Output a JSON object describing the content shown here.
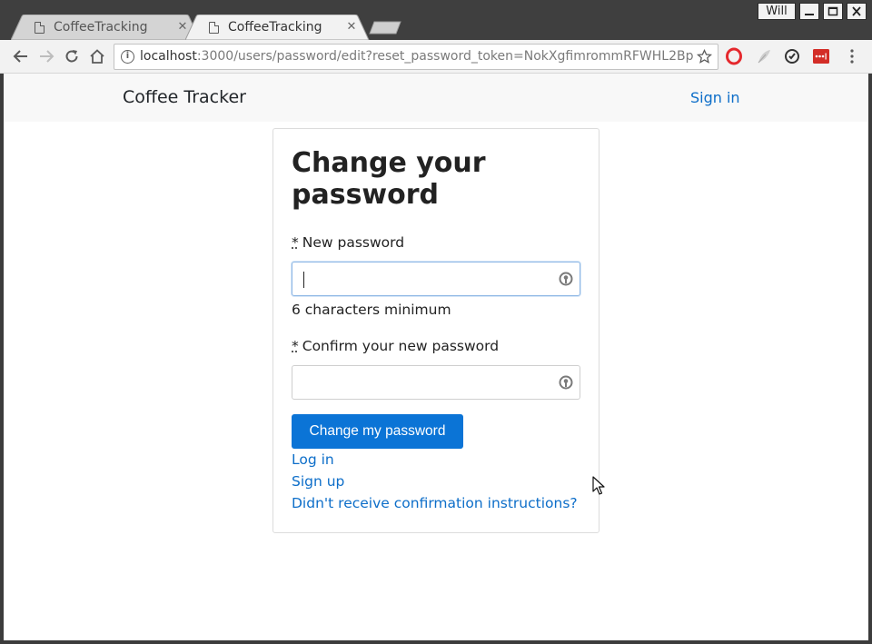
{
  "browser": {
    "tabs": [
      {
        "title": "CoffeeTracking",
        "active": false
      },
      {
        "title": "CoffeeTracking",
        "active": true
      }
    ],
    "profile_name": "Will",
    "address_bar": {
      "host": "localhost",
      "rest": ":3000/users/password/edit?reset_password_token=NokXgfimrommRFWHL2Bp"
    },
    "icons": {
      "back": "arrow-left-icon",
      "forward": "arrow-right-icon",
      "reload": "reload-icon",
      "home": "home-icon",
      "bookmark": "star-icon",
      "menu": "kebab-menu-icon"
    },
    "extensions": [
      "opera-icon",
      "feather-icon",
      "sync-icon",
      "lastpass-icon"
    ]
  },
  "navbar": {
    "brand": "Coffee Tracker",
    "sign_in": "Sign in"
  },
  "form": {
    "title": "Change your password",
    "required_marker": "*",
    "new_password_label": "New password",
    "new_password_hint": "6 characters minimum",
    "confirm_password_label": "Confirm your new password",
    "submit_label": "Change my password",
    "links": {
      "log_in": "Log in",
      "sign_up": "Sign up",
      "confirmation": "Didn't receive confirmation instructions?"
    }
  },
  "colors": {
    "link": "#0d6ec9",
    "primary_button": "#0b74d6",
    "navbar_bg": "#f8f8f8",
    "focus_border": "#8fb8e5"
  }
}
